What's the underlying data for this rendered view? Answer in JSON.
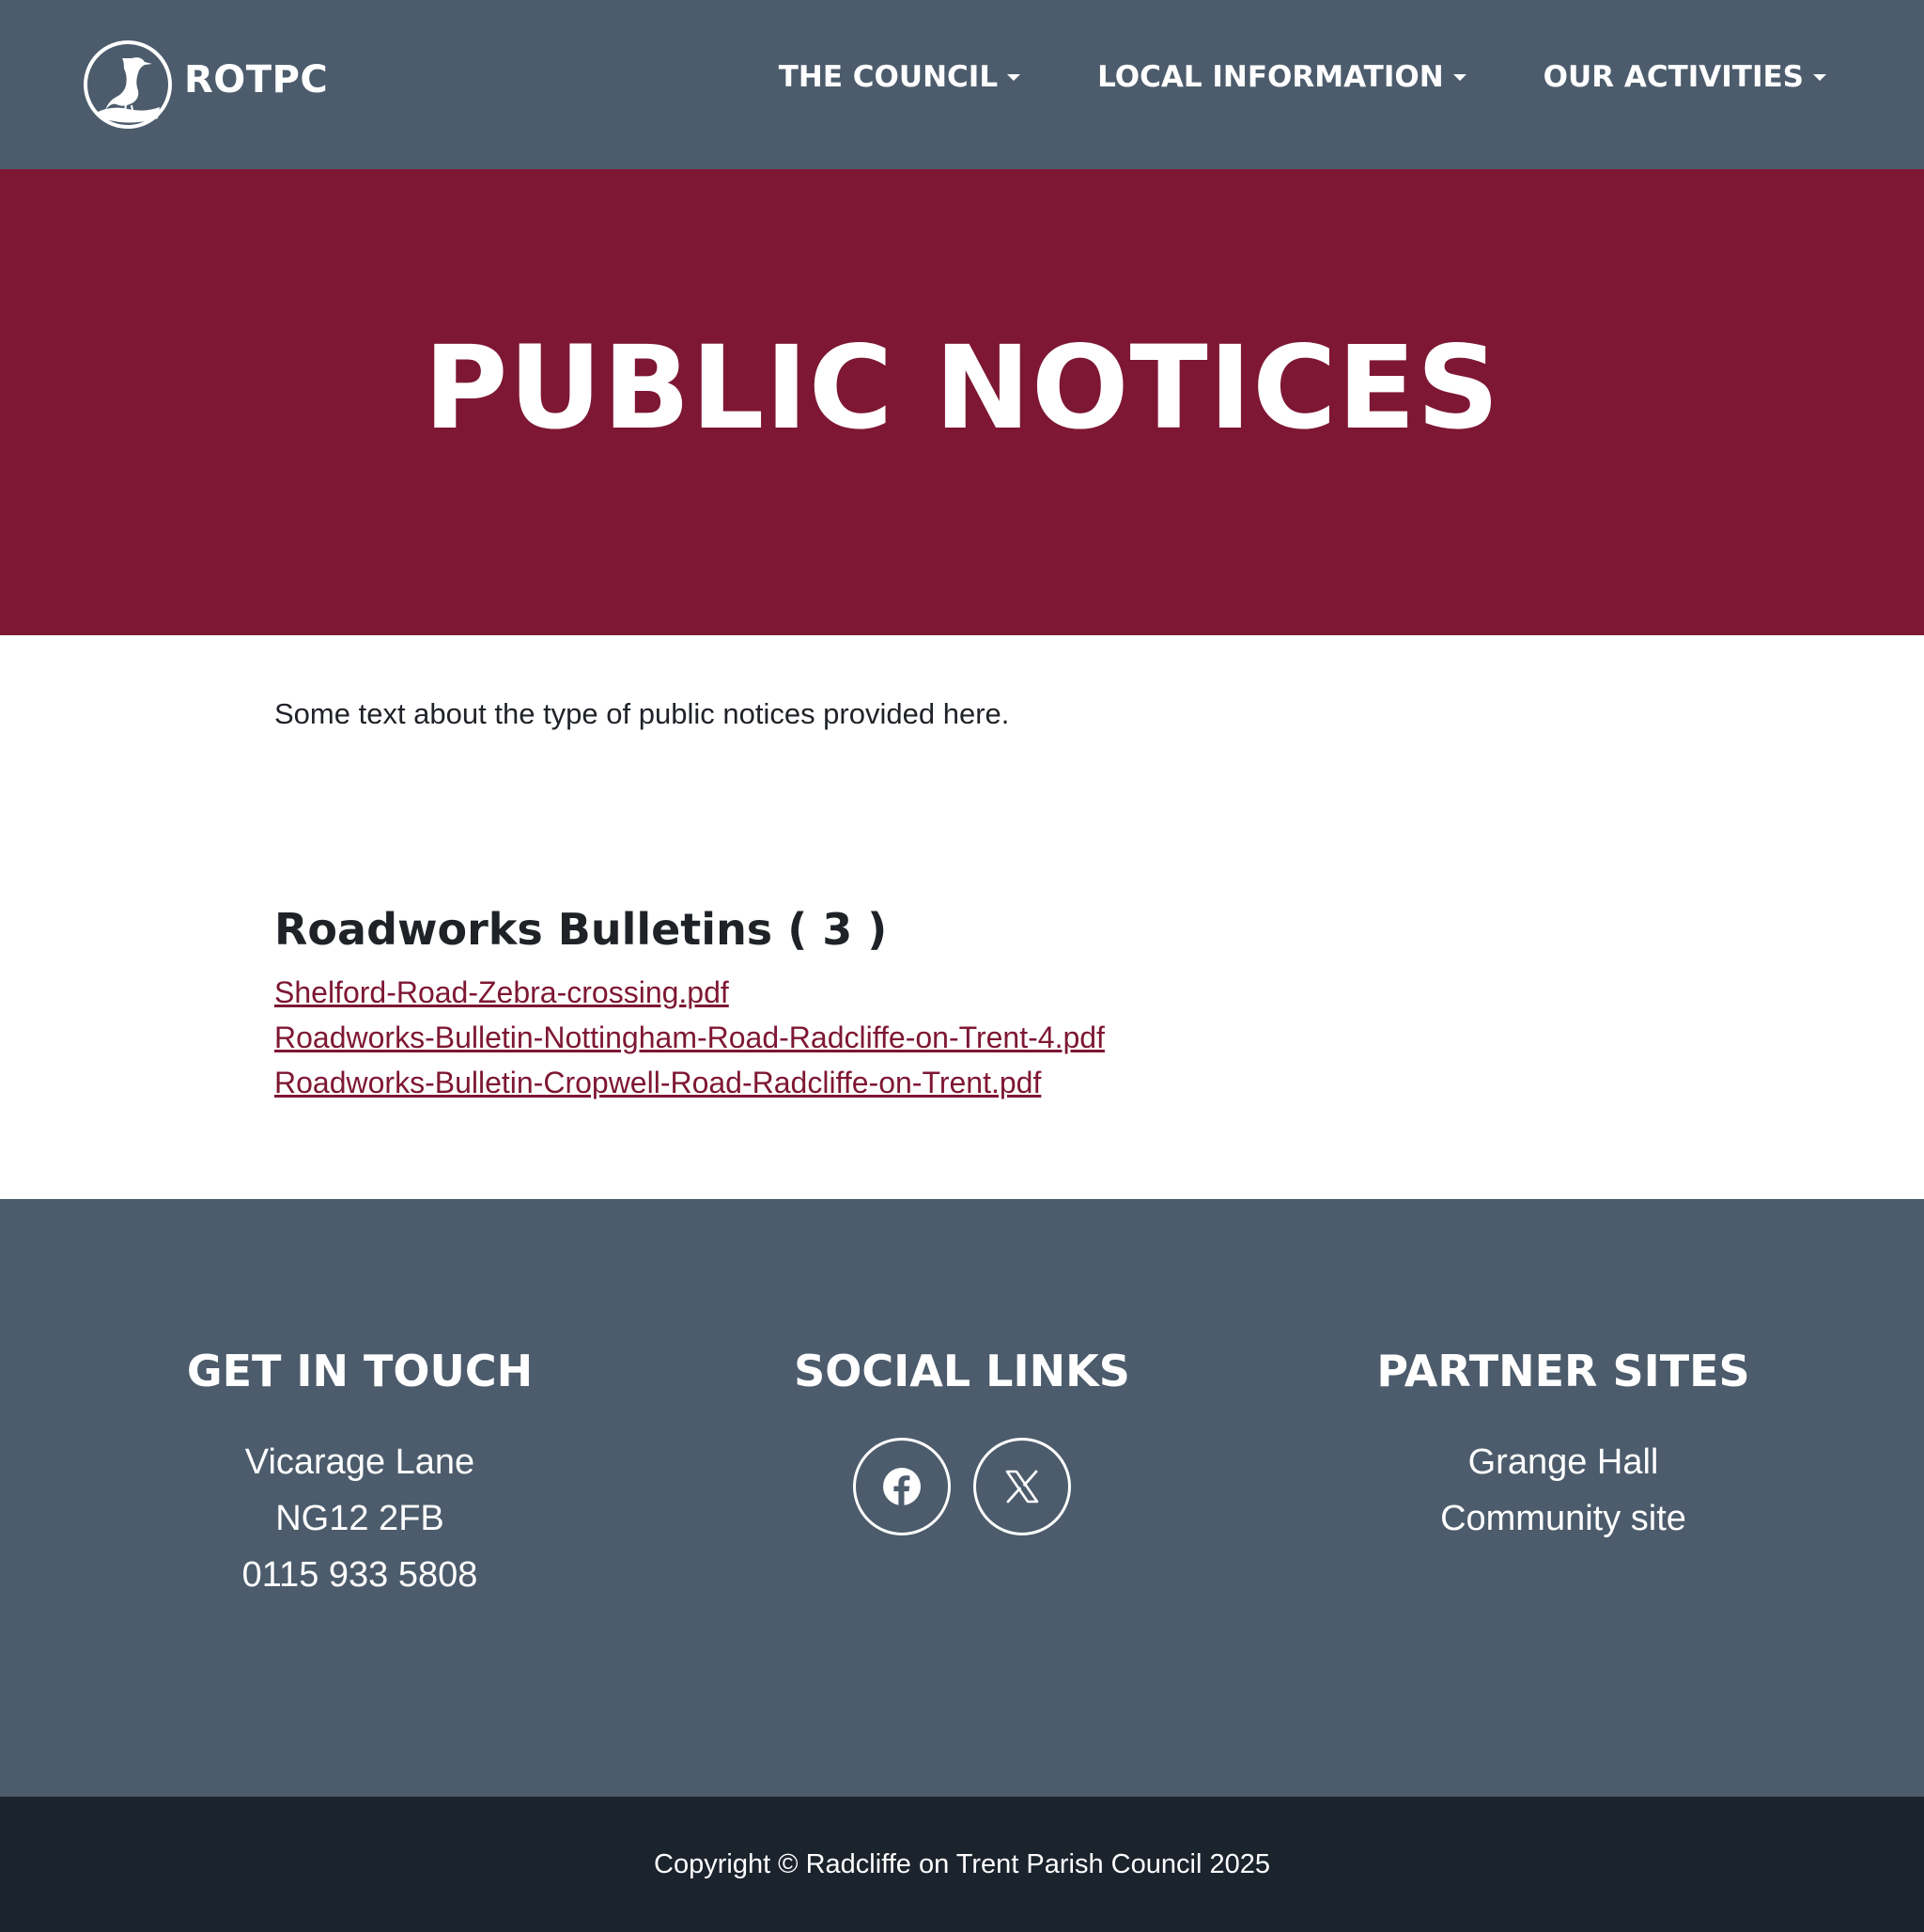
{
  "header": {
    "logo_text": "ROTPC",
    "logo_icon": "heron-icon",
    "nav": [
      {
        "label": "THE COUNCIL",
        "icon": "caret-down-icon"
      },
      {
        "label": "LOCAL INFORMATION",
        "icon": "caret-down-icon"
      },
      {
        "label": "OUR ACTIVITIES",
        "icon": "caret-down-icon"
      }
    ]
  },
  "hero": {
    "title": "PUBLIC NOTICES"
  },
  "main": {
    "intro": "Some text about the type of public notices provided here.",
    "section_heading": "Roadworks Bulletins ( 3 )",
    "documents": [
      "Shelford-Road-Zebra-crossing.pdf",
      "Roadworks-Bulletin-Nottingham-Road-Radcliffe-on-Trent-4.pdf",
      "Roadworks-Bulletin-Cropwell-Road-Radcliffe-on-Trent.pdf"
    ]
  },
  "footer": {
    "contact": {
      "heading": "GET IN TOUCH",
      "lines": [
        "Vicarage Lane",
        "NG12 2FB",
        "0115 933 5808"
      ]
    },
    "social": {
      "heading": "SOCIAL LINKS",
      "icons": [
        "facebook-icon",
        "x-icon"
      ]
    },
    "partners": {
      "heading": "PARTNER SITES",
      "links": [
        "Grange Hall",
        "Community site"
      ]
    },
    "copyright": "Copyright © Radcliffe on Trent Parish Council 2025"
  },
  "colors": {
    "header_bg": "#4c5c6c",
    "hero_bg": "#7e1734",
    "link": "#7e1734",
    "copyright_bg": "#1b232d"
  }
}
